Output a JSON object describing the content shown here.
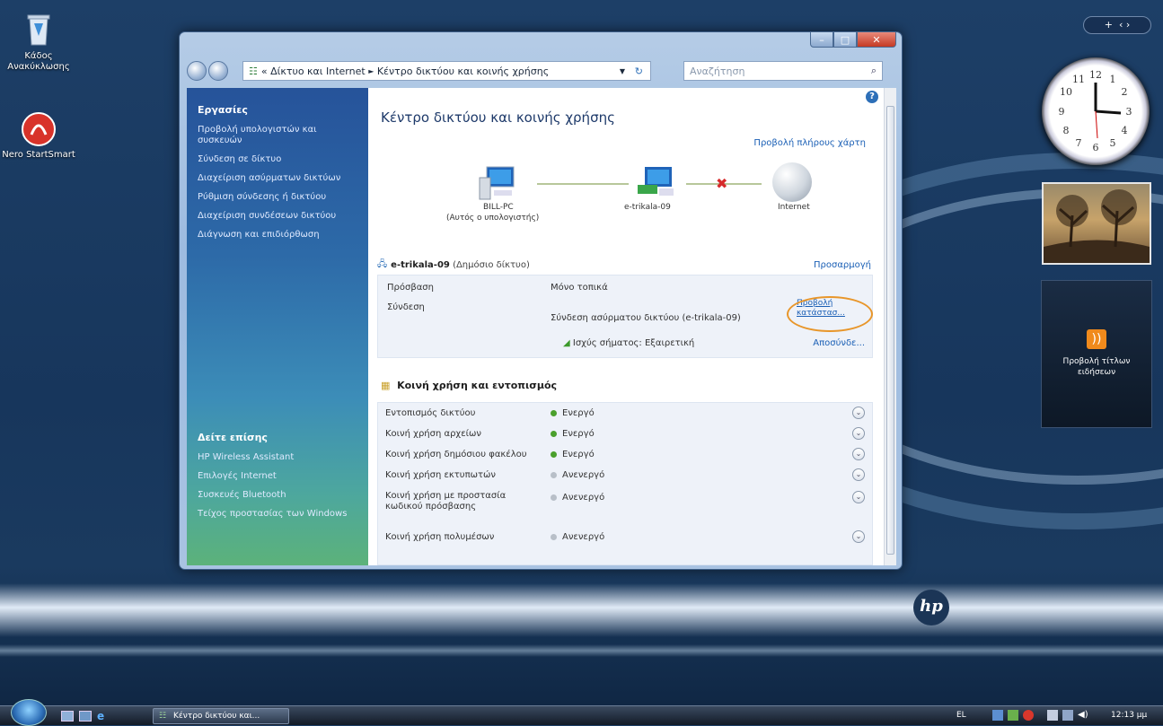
{
  "desktop": {
    "icons": [
      {
        "label": "Κάδος Ανακύκλωσης",
        "icon": "recycle-bin-icon"
      },
      {
        "label": "Nero StartSmart",
        "icon": "nero-icon"
      }
    ],
    "brand": "hp"
  },
  "window": {
    "breadcrumb": {
      "prefix": "«",
      "part1": "Δίκτυο και Internet",
      "sep": "►",
      "part2": "Κέντρο δικτύου και κοινής χρήσης"
    },
    "search_placeholder": "Αναζήτηση",
    "sidebar": {
      "tasks_title": "Εργασίες",
      "tasks": [
        "Προβολή υπολογιστών και συσκευών",
        "Σύνδεση σε δίκτυο",
        "Διαχείριση ασύρματων δικτύων",
        "Ρύθμιση σύνδεσης ή δικτύου",
        "Διαχείριση συνδέσεων δικτύου",
        "Διάγνωση και επιδιόρθωση"
      ],
      "see_also_title": "Δείτε επίσης",
      "see_also": [
        "HP Wireless Assistant",
        "Επιλογές Internet",
        "Συσκευές Bluetooth",
        "Τείχος προστασίας των Windows"
      ]
    },
    "main": {
      "title": "Κέντρο δικτύου και κοινής χρήσης",
      "full_map_link": "Προβολή πλήρους χάρτη",
      "map": {
        "pc_name": "BILL-PC",
        "pc_sub": "(Αυτός ο υπολογιστής)",
        "network": "e-trikala-09",
        "internet": "Internet"
      },
      "network": {
        "name": "e-trikala-09",
        "type": "(Δημόσιο δίκτυο)",
        "customize": "Προσαρμογή",
        "access_label": "Πρόσβαση",
        "access_value": "Μόνο τοπικά",
        "connection_label": "Σύνδεση",
        "connection_value": "Σύνδεση ασύρματου δικτύου (e-trikala-09)",
        "view_status_line1": "Προβολή",
        "view_status_line2": "κατάστασ...",
        "signal": "Ισχύς σήματος: Εξαιρετική",
        "disconnect": "Αποσύνδε..."
      },
      "sharing_title": "Κοινή χρήση και εντοπισμός",
      "sharing": [
        {
          "label": "Εντοπισμός δικτύου",
          "status": "Ενεργό",
          "on": true
        },
        {
          "label": "Κοινή χρήση αρχείων",
          "status": "Ενεργό",
          "on": true
        },
        {
          "label": "Κοινή χρήση δημόσιου φακέλου",
          "status": "Ενεργό",
          "on": true
        },
        {
          "label": "Κοινή χρήση εκτυπωτών",
          "status": "Ανενεργό",
          "on": false
        },
        {
          "label": "Κοινή χρήση με προστασία κωδικού πρόσβασης",
          "status": "Ανενεργό",
          "on": false
        },
        {
          "label": "Κοινή χρήση πολυμέσων",
          "status": "Ανενεργό",
          "on": false
        }
      ]
    }
  },
  "gadgets": {
    "feed_title": "Προβολή τίτλων ειδήσεων",
    "clock_numbers": [
      "12",
      "1",
      "2",
      "3",
      "4",
      "5",
      "6",
      "7",
      "8",
      "9",
      "10",
      "11"
    ]
  },
  "taskbar": {
    "task": "Κέντρο δικτύου και...",
    "lang": "EL",
    "time": "12:13 μμ"
  },
  "colors": {
    "link": "#1a5fb5",
    "active": "#4aa02c",
    "highlight_ring": "#e8962a"
  }
}
